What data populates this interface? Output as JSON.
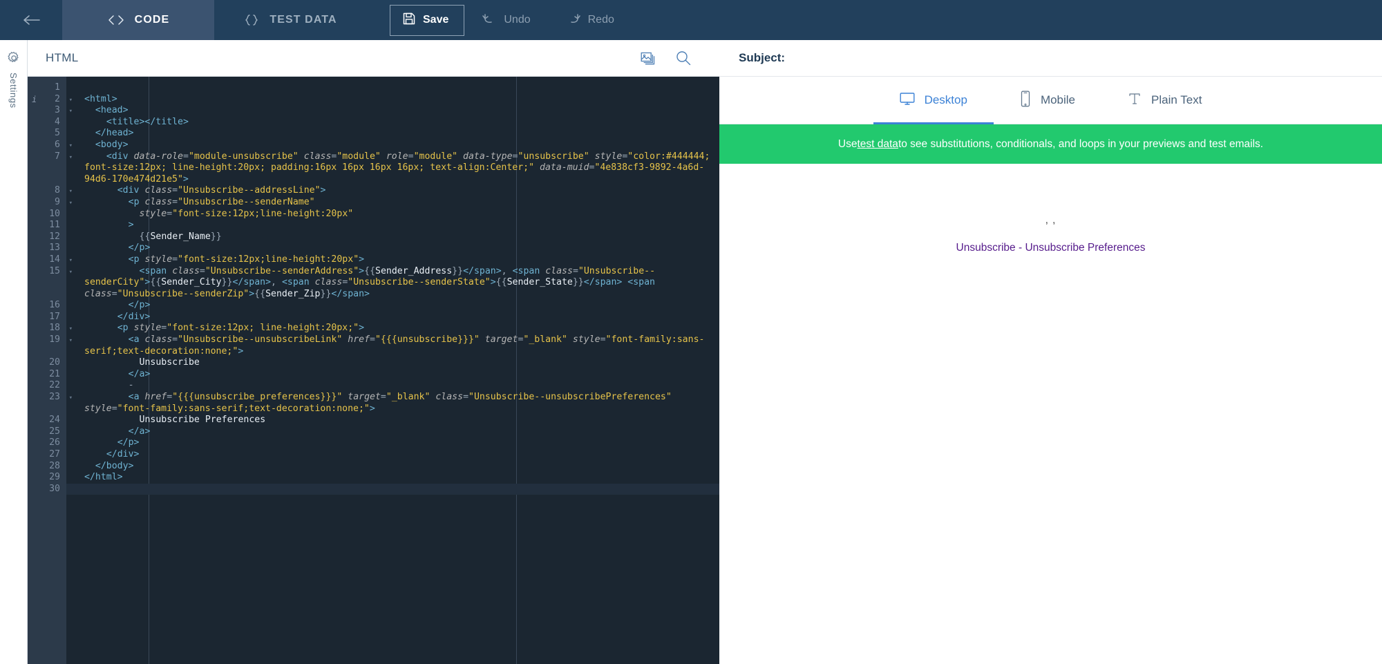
{
  "topbar": {
    "back_icon": "arrow-left-icon",
    "tabs": [
      {
        "label": "CODE",
        "icon": "code-brackets-icon",
        "active": true
      },
      {
        "label": "TEST DATA",
        "icon": "curly-braces-icon",
        "active": false
      }
    ],
    "save_label": "Save",
    "save_icon": "floppy-disk-icon",
    "undo_label": "Undo",
    "undo_icon": "undo-arrow-icon",
    "redo_label": "Redo",
    "redo_icon": "redo-arrow-icon"
  },
  "rail": {
    "settings_label": "Settings",
    "settings_icon": "gear-icon"
  },
  "code_panel": {
    "language_label": "HTML",
    "image_icon": "image-stack-icon",
    "search_icon": "search-icon",
    "total_lines": 30,
    "active_line": 30,
    "info_marker_line": 2,
    "fold_lines": [
      2,
      3,
      6,
      7,
      8,
      9,
      14,
      15,
      18,
      19,
      23
    ],
    "lines": [
      {
        "n": 1,
        "text": ""
      },
      {
        "n": 2,
        "text": "<html>"
      },
      {
        "n": 3,
        "text": "  <head>"
      },
      {
        "n": 4,
        "text": "    <title></title>"
      },
      {
        "n": 5,
        "text": "  </head>"
      },
      {
        "n": 6,
        "text": "  <body>"
      },
      {
        "n": 7,
        "text": "    <div data-role=\"module-unsubscribe\" class=\"module\" role=\"module\" data-type=\"unsubscribe\" style=\"color:#444444; font-size:12px; line-height:20px; padding:16px 16px 16px 16px; text-align:Center;\" data-muid=\"4e838cf3-9892-4a6d-94d6-170e474d21e5\">"
      },
      {
        "n": 8,
        "text": "      <div class=\"Unsubscribe--addressLine\">"
      },
      {
        "n": 9,
        "text": "        <p class=\"Unsubscribe--senderName\""
      },
      {
        "n": 10,
        "text": "          style=\"font-size:12px;line-height:20px\""
      },
      {
        "n": 11,
        "text": "        >"
      },
      {
        "n": 12,
        "text": "          {{Sender_Name}}"
      },
      {
        "n": 13,
        "text": "        </p>"
      },
      {
        "n": 14,
        "text": "        <p style=\"font-size:12px;line-height:20px\">"
      },
      {
        "n": 15,
        "text": "          <span class=\"Unsubscribe--senderAddress\">{{Sender_Address}}</span>, <span class=\"Unsubscribe--senderCity\">{{Sender_City}}</span>, <span class=\"Unsubscribe--senderState\">{{Sender_State}}</span> <span class=\"Unsubscribe--senderZip\">{{Sender_Zip}}</span>"
      },
      {
        "n": 16,
        "text": "        </p>"
      },
      {
        "n": 17,
        "text": "      </div>"
      },
      {
        "n": 18,
        "text": "      <p style=\"font-size:12px; line-height:20px;\">"
      },
      {
        "n": 19,
        "text": "        <a class=\"Unsubscribe--unsubscribeLink\" href=\"{{{unsubscribe}}}\" target=\"_blank\" style=\"font-family:sans-serif;text-decoration:none;\">"
      },
      {
        "n": 20,
        "text": "          Unsubscribe"
      },
      {
        "n": 21,
        "text": "        </a>"
      },
      {
        "n": 22,
        "text": "        -"
      },
      {
        "n": 23,
        "text": "        <a href=\"{{{unsubscribe_preferences}}}\" target=\"_blank\" class=\"Unsubscribe--unsubscribePreferences\" style=\"font-family:sans-serif;text-decoration:none;\">"
      },
      {
        "n": 24,
        "text": "          Unsubscribe Preferences"
      },
      {
        "n": 25,
        "text": "        </a>"
      },
      {
        "n": 26,
        "text": "      </p>"
      },
      {
        "n": 27,
        "text": "    </div>"
      },
      {
        "n": 28,
        "text": "  </body>"
      },
      {
        "n": 29,
        "text": "</html>"
      },
      {
        "n": 30,
        "text": ""
      }
    ]
  },
  "preview": {
    "subject_label": "Subject:",
    "subject_value": "",
    "view_tabs": [
      {
        "label": "Desktop",
        "icon": "desktop-monitor-icon",
        "active": true
      },
      {
        "label": "Mobile",
        "icon": "mobile-phone-icon",
        "active": false
      },
      {
        "label": "Plain Text",
        "icon": "text-t-icon",
        "active": false
      }
    ],
    "banner": {
      "prefix": "Use ",
      "link": "test data",
      "suffix": " to see substitutions, conditionals, and loops in your previews and test emails."
    },
    "content": {
      "address_line": ", ,",
      "unsubscribe_link": "Unsubscribe",
      "separator": " - ",
      "preferences_link": "Unsubscribe Preferences"
    }
  },
  "colors": {
    "topbar_bg": "#22405c",
    "tab_active_bg": "#3b5370",
    "editor_bg": "#1b2631",
    "gutter_bg": "#2c3a4a",
    "banner_green": "#22c96e",
    "accent_blue": "#3c82d6",
    "link_purple": "#551a8b"
  }
}
